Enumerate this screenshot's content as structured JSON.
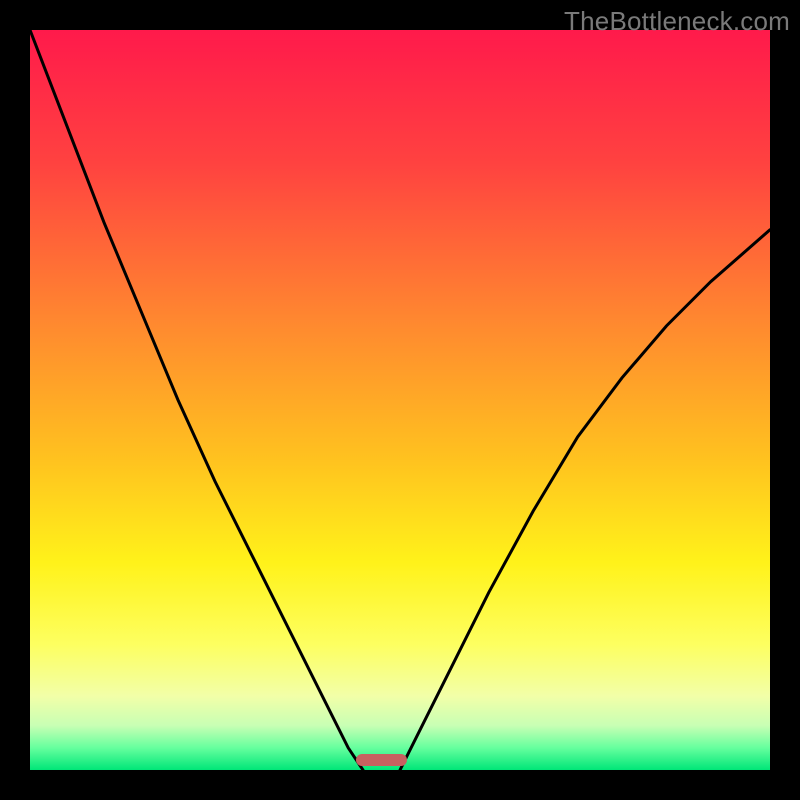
{
  "watermark": "TheBottleneck.com",
  "chart_data": {
    "type": "line",
    "title": "",
    "xlabel": "",
    "ylabel": "",
    "xlim": [
      0,
      100
    ],
    "ylim": [
      0,
      100
    ],
    "grid": false,
    "legend": false,
    "background_gradient_stops": [
      {
        "pct": 0,
        "color": "#ff1a4b"
      },
      {
        "pct": 18,
        "color": "#ff4240"
      },
      {
        "pct": 40,
        "color": "#ff8a2f"
      },
      {
        "pct": 58,
        "color": "#ffc21f"
      },
      {
        "pct": 72,
        "color": "#fff21a"
      },
      {
        "pct": 83,
        "color": "#fdff60"
      },
      {
        "pct": 90,
        "color": "#f2ffa8"
      },
      {
        "pct": 94,
        "color": "#c8ffb4"
      },
      {
        "pct": 97,
        "color": "#66ff9e"
      },
      {
        "pct": 100,
        "color": "#00e678"
      }
    ],
    "series": [
      {
        "name": "left-curve",
        "x": [
          0,
          5,
          10,
          15,
          20,
          25,
          30,
          35,
          40,
          43,
          45
        ],
        "y": [
          100,
          87,
          74,
          62,
          50,
          39,
          29,
          19,
          9,
          3,
          0
        ]
      },
      {
        "name": "right-curve",
        "x": [
          50,
          53,
          57,
          62,
          68,
          74,
          80,
          86,
          92,
          100
        ],
        "y": [
          0,
          6,
          14,
          24,
          35,
          45,
          53,
          60,
          66,
          73
        ]
      }
    ],
    "marker": {
      "name": "bottleneck-region",
      "x_start": 44,
      "x_end": 51,
      "y": 0,
      "height_pct": 1.6
    }
  }
}
